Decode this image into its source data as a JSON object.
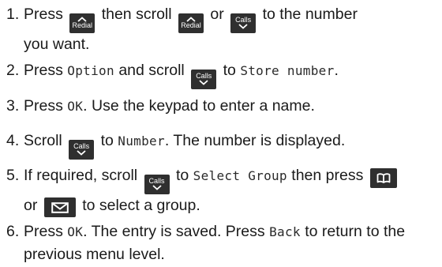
{
  "steps": [
    {
      "num": "1.",
      "t1": "Press",
      "t2": "then scroll",
      "t3": "or",
      "t4": "to the number",
      "t5": "you want."
    },
    {
      "num": "2.",
      "t1": "Press",
      "d1": "Option",
      "t2": "and scroll",
      "t3": "to",
      "d2": "Store number",
      "t4": "."
    },
    {
      "num": "3.",
      "t1": "Press",
      "d1": "OK",
      "t2": ". Use the keypad to enter a name."
    },
    {
      "num": "4.",
      "t1": "Scroll",
      "t2": "to",
      "d1": "Number",
      "t3": ". The number is displayed."
    },
    {
      "num": "5.",
      "t1": "If required, scroll",
      "t2": "to",
      "d1": "Select Group",
      "t3": "then press",
      "t4": "or",
      "t5": "to select a group."
    },
    {
      "num": "6.",
      "t1": "Press",
      "d1": "OK",
      "t2": ". The entry is saved. Press",
      "d2": "Back",
      "t3": "to return to the",
      "t4": "previous menu level."
    }
  ],
  "keys": {
    "redial": {
      "label": "Redial",
      "icon": "chevron-up-icon"
    },
    "calls": {
      "label": "Calls",
      "icon": "chevron-down-icon"
    },
    "phonebook": {
      "icon": "phonebook-icon"
    },
    "message": {
      "icon": "envelope-icon"
    }
  }
}
